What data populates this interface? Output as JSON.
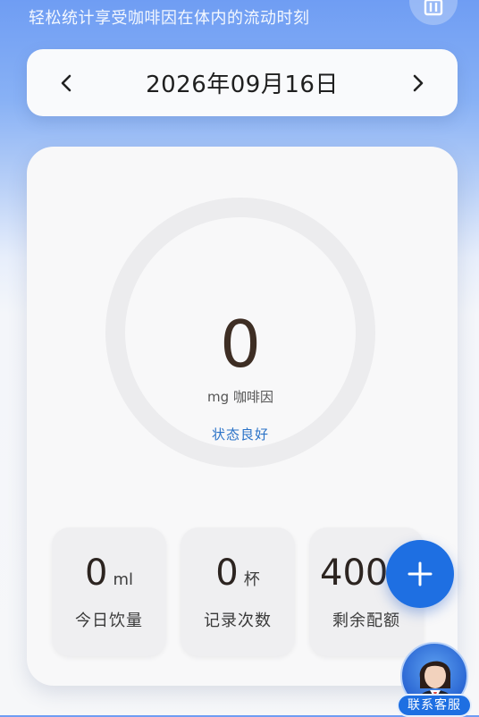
{
  "header": {
    "subtitle": "轻松统计享受咖啡因在体内的流动时刻",
    "top_button_icon": "trash-icon"
  },
  "date_bar": {
    "date": "2026年09月16日",
    "prev_icon": "chevron-left-icon",
    "next_icon": "chevron-right-icon"
  },
  "summary": {
    "caffeine_value": "0",
    "caffeine_unit": "mg 咖啡因",
    "status": "状态良好",
    "ring_progress": 0
  },
  "stats": [
    {
      "value": "0",
      "unit": "ml",
      "label": "今日饮量"
    },
    {
      "value": "0",
      "unit": "杯",
      "label": "记录次数"
    },
    {
      "value": "400",
      "unit": "",
      "label": "剩余配额"
    }
  ],
  "fab": {
    "icon": "plus-icon"
  },
  "support": {
    "label": "联系客服"
  },
  "colors": {
    "accent": "#1e6fe2",
    "status": "#2a72c7",
    "ring_track": "#ececee"
  }
}
